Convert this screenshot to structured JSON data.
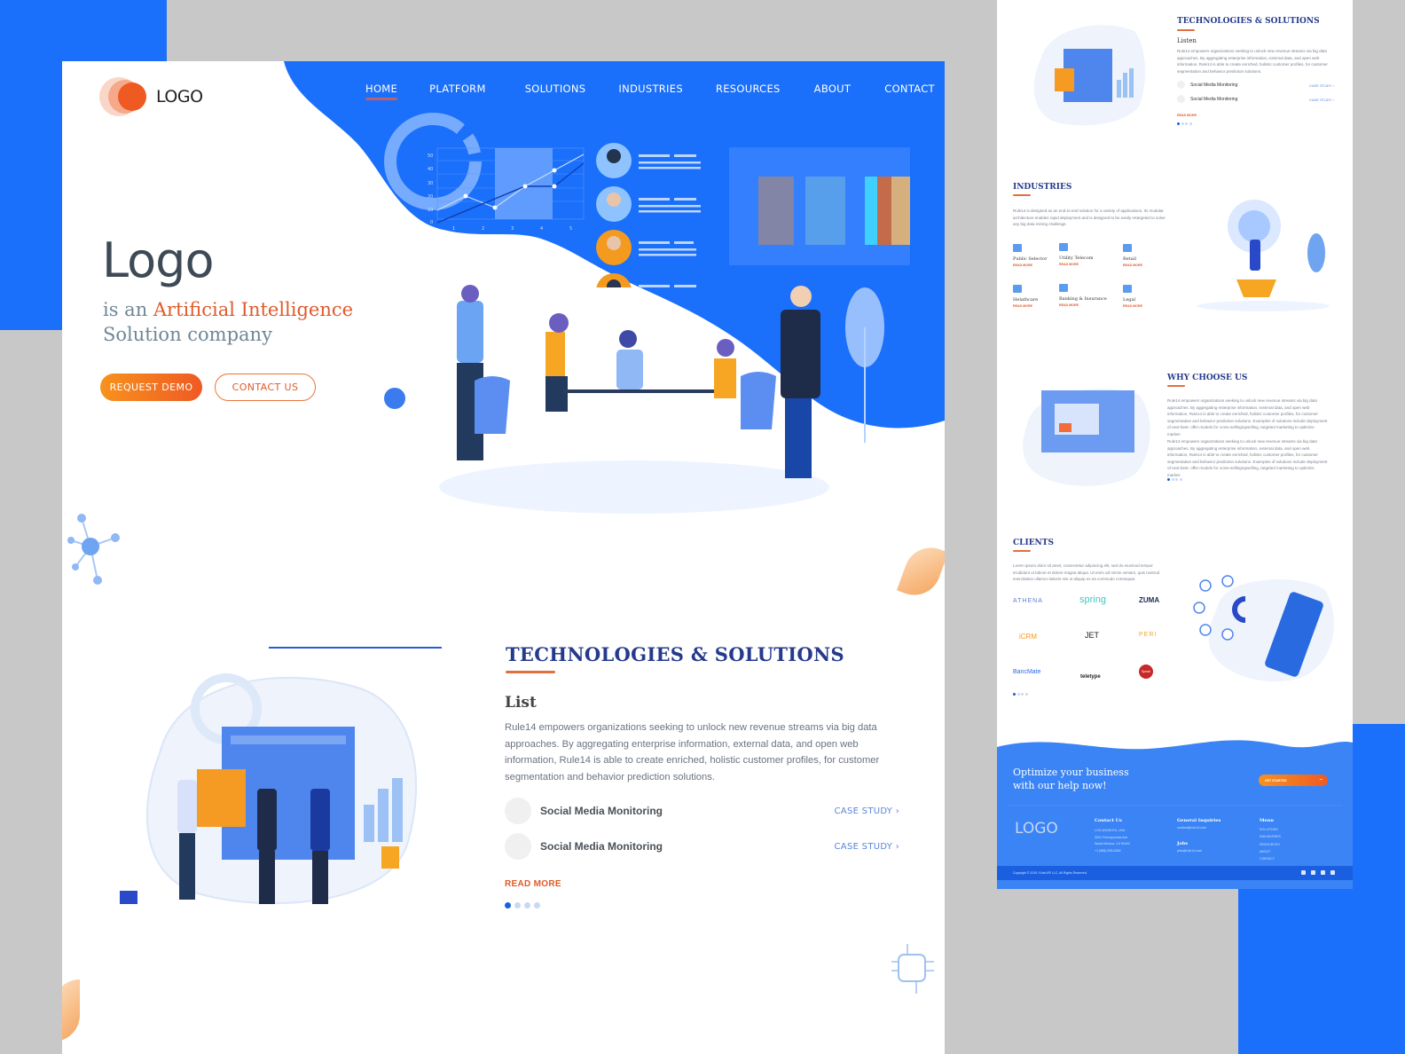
{
  "brand": {
    "logo_text": "LOGO",
    "colors": {
      "primary": "#1a6ffb",
      "accent": "#ef5a23",
      "heading": "#253a8c"
    }
  },
  "nav": {
    "items": [
      {
        "label": "HOME",
        "active": true
      },
      {
        "label": "PLATFORM"
      },
      {
        "label": "SOLUTIONS"
      },
      {
        "label": "INDUSTRIES"
      },
      {
        "label": "RESOURCES"
      },
      {
        "label": "ABOUT"
      },
      {
        "label": "CONTACT"
      }
    ]
  },
  "hero": {
    "title": "Logo",
    "sub_prefix": "is an ",
    "sub_accent": "Artificial Intelligence",
    "sub_line2": "Solution company",
    "request_demo": "REQUEST DEMO",
    "contact_us": "CONTACT US",
    "chart_y_ticks": [
      "0",
      "10",
      "20",
      "30",
      "40",
      "50"
    ],
    "chart_x_ticks": [
      "1",
      "2",
      "3",
      "4",
      "5"
    ]
  },
  "tech": {
    "title": "TECHNOLOGIES & SOLUTIONS",
    "list_title": "List",
    "body": "Rule14 empowers organizations seeking to unlock new revenue streams via big data approaches. By aggregating enterprise information, external data, and open web information, Rule14 is able to create enriched, holistic customer profiles, for customer segmentation and behavior prediction solutions.",
    "items": [
      {
        "label": "Social Media Monitoring",
        "link": "CASE STUDY ›"
      },
      {
        "label": "Social Media Monitoring",
        "link": "CASE STUDY ›"
      }
    ],
    "read_more": "READ MORE",
    "slides": 4,
    "active_slide": 1
  },
  "preview": {
    "tech": {
      "title": "TECHNOLOGIES & SOLUTIONS",
      "list_title": "Listen",
      "body": "Rule14 empowers organizations seeking to unlock new revenue streams via big data approaches. By aggregating enterprise information, external data, and open web information, Rule14 is able to create enriched, holistic customer profiles, for customer segmentation and behavior prediction solutions.",
      "items": [
        {
          "label": "Social Media Monitoring",
          "link": "CASE STUDY ›"
        },
        {
          "label": "Social Media Monitoring",
          "link": "CASE STUDY ›"
        }
      ],
      "read_more": "READ MORE"
    },
    "industries": {
      "title": "INDUSTRIES",
      "body": "Rule14 is designed as an end-to-end solution for a variety of applications. Its modular architecture enables rapid deployment and is designed to be easily retargeted to solve any big data mining challenge.",
      "items": [
        {
          "label": "Public Selector",
          "link": "READ MORE"
        },
        {
          "label": "Utility Telecom",
          "link": "READ MORE"
        },
        {
          "label": "Retail",
          "link": "READ MORE"
        },
        {
          "label": "Helathcare",
          "link": "READ MORE"
        },
        {
          "label": "Banking & Insurance",
          "link": "READ MORE"
        },
        {
          "label": "Legal",
          "link": "READ MORE"
        }
      ]
    },
    "why": {
      "title": "WHY CHOOSE US",
      "para1": "Rule14 empowers organizations seeking to unlock new revenue streams via big data approaches. By aggregating enterprise information, external data, and open web information, Rule14 is able to create enriched, holistic customer profiles, for customer segmentation and behavior prediction solutions. Examples of solutions include deployment of next-best- offer models for cross-selling/upselling, targeted marketing to optimize market-",
      "para2": "Rule14 empowers organizations seeking to unlock new revenue streams via big data approaches. By aggregating enterprise information, external data, and open web information, Rule14 is able to create enriched, holistic customer profiles, for customer segmentation and behavior prediction solutions. Examples of solutions include deployment of next-best- offer models for cross-selling/upselling, targeted marketing to optimize market-"
    },
    "clients": {
      "title": "CLIENTS",
      "body": "Lorem ipsum dolor sit amet, consectetur adipiscing elit, sed do eiusmod tempor incididunt ut labore et dolore magna aliqua. Ut enim ad minim veniam, quis nostrud exercitation ullamco laboris nisi ut aliquip ex ea commodo consequat.",
      "logos": [
        "ATHENA",
        "spring",
        "ZUMA",
        "iCRM",
        "JET",
        "PERI",
        "BancMate",
        "teletype",
        "Speak UP!"
      ]
    },
    "cta": {
      "text_line1": "Optimize your business",
      "text_line2": "with our help now!",
      "button": "GET STARTED"
    },
    "footer": {
      "logo": "LOGO",
      "contact_title": "Contact Us",
      "contact_lines": [
        "LOS ANGELES, USA",
        "3001 Pennsylvania Ave",
        "Santa Monica, CA 90404",
        "+1 (888) 835-6282"
      ],
      "inquiries_title": "General Inquiries",
      "inquiries_email": "contact@rule14.com",
      "jobs_title": "Jobs",
      "jobs_email": "jobs@rule14.com",
      "menu_title": "Menu",
      "menu_items": [
        "SOLUTIONS",
        "INDUSATRIES",
        "RESOURCES",
        "ABOUT",
        "CONTACT"
      ],
      "copyright": "Copyright © 2019, Rule14® LLC, All Rights Reserved.",
      "social": [
        "facebook-icon",
        "instagram-icon",
        "twitter-icon",
        "linkedin-icon"
      ]
    }
  }
}
